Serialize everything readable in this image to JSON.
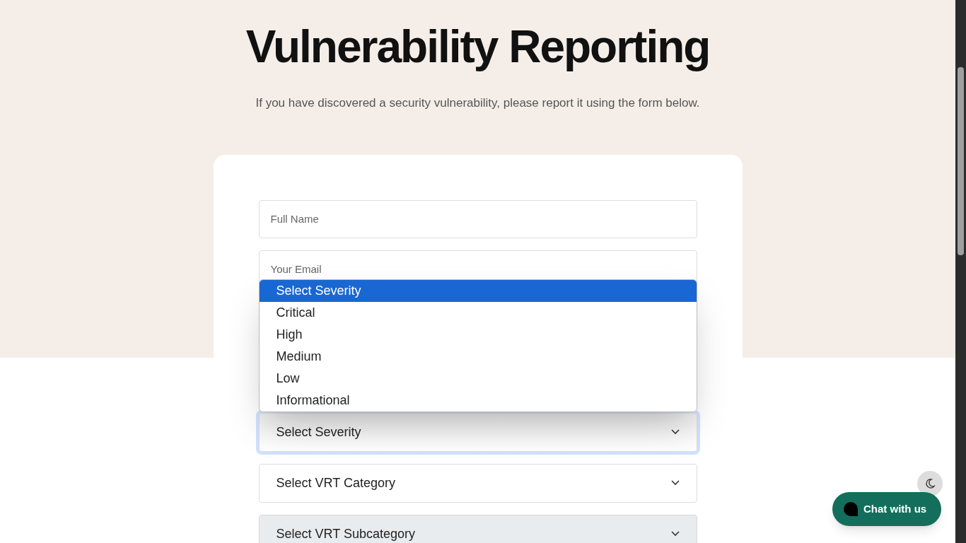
{
  "heading": "Vulnerability Reporting",
  "subtitle": "If you have discovered a security vulnerability, please report it using the form below.",
  "fields": [
    {
      "placeholder": "Full Name"
    },
    {
      "placeholder": "Your Email"
    }
  ],
  "selects": [
    {
      "label": "Select Severity",
      "focused": true,
      "disabled": false
    },
    {
      "label": "Select VRT Category",
      "focused": false,
      "disabled": false
    },
    {
      "label": "Select VRT Subcategory",
      "focused": false,
      "disabled": true
    }
  ],
  "severity_options": [
    {
      "label": "Select Severity",
      "selected": true
    },
    {
      "label": "Critical",
      "selected": false
    },
    {
      "label": "High",
      "selected": false
    },
    {
      "label": "Medium",
      "selected": false
    },
    {
      "label": "Low",
      "selected": false
    },
    {
      "label": "Informational",
      "selected": false
    }
  ],
  "chat_button": {
    "label": "Chat with us"
  }
}
